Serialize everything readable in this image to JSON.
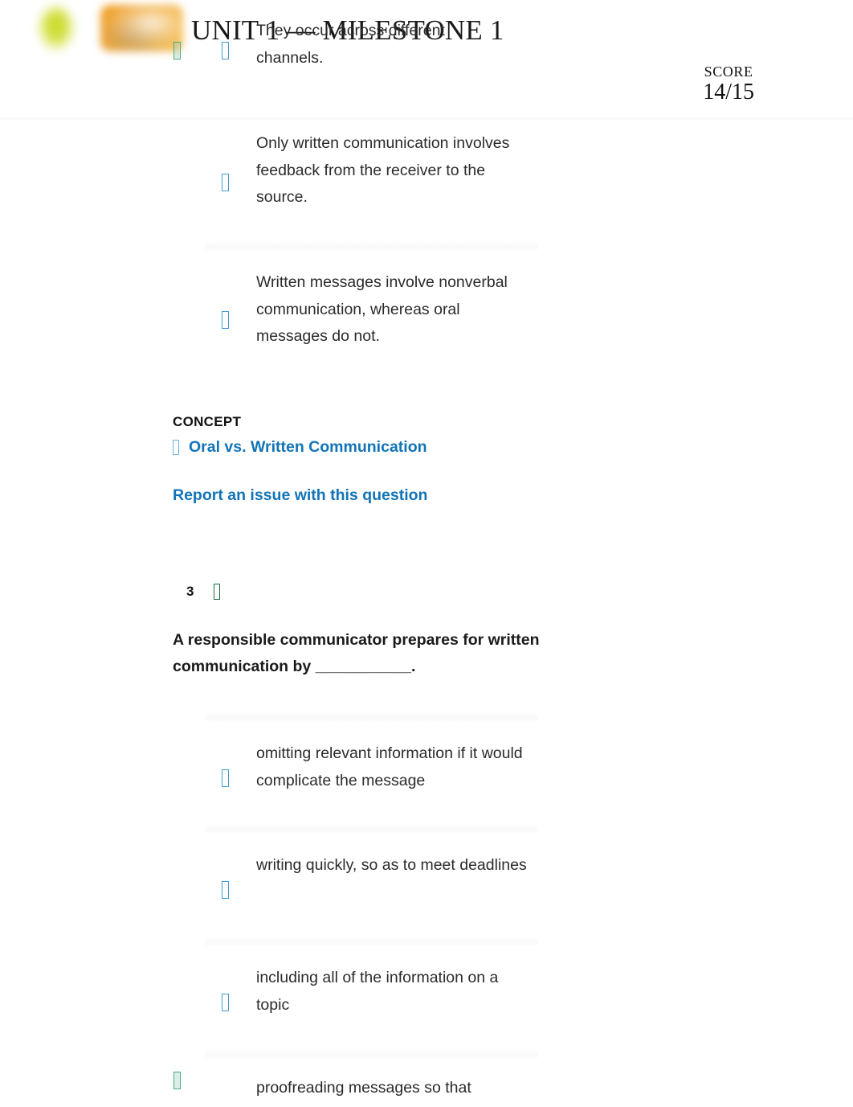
{
  "header": {
    "unit_title": "UNIT 1 — MILESTONE 1",
    "score_label": "SCORE",
    "score_value": "14/15",
    "logo_leaf": "sophia-leaf-logo",
    "logo_tile": "orange-tile-logo"
  },
  "overlapped_fragment": {
    "text": "They occur across different channels."
  },
  "question_2_remaining_options": [
    {
      "radio": "radio-unselected",
      "text": "Only written communication involves feedback from the receiver to the source."
    },
    {
      "radio": "radio-unselected",
      "text": "Written messages involve nonverbal communication, whereas oral messages do not."
    }
  ],
  "concept": {
    "label": "CONCEPT",
    "link_icon": "concept-book-icon",
    "link_text": "Oral vs. Written Communication",
    "report_link": "Report an issue with this question"
  },
  "question_3": {
    "number": "3",
    "status_icon": "correct-check-icon",
    "stem": "A responsible communicator prepares for written communication by ___________.",
    "options": [
      {
        "radio": "radio-unselected",
        "correct_marker": "",
        "text": "omitting relevant information if it would complicate the message"
      },
      {
        "radio": "radio-unselected",
        "correct_marker": "",
        "text": "writing quickly, so as to meet deadlines"
      },
      {
        "radio": "radio-unselected",
        "correct_marker": "",
        "text": "including all of the information on a topic"
      },
      {
        "radio": "radio-unselected",
        "correct_marker": "correct-answer-icon",
        "text": "proofreading messages so that"
      }
    ]
  },
  "colors": {
    "link_blue": "#1274b7",
    "radio_blue": "#3f9bd0",
    "correct_green": "#4aab84",
    "text_dark": "#2b2b2b",
    "separator_gray": "#fafafb"
  }
}
